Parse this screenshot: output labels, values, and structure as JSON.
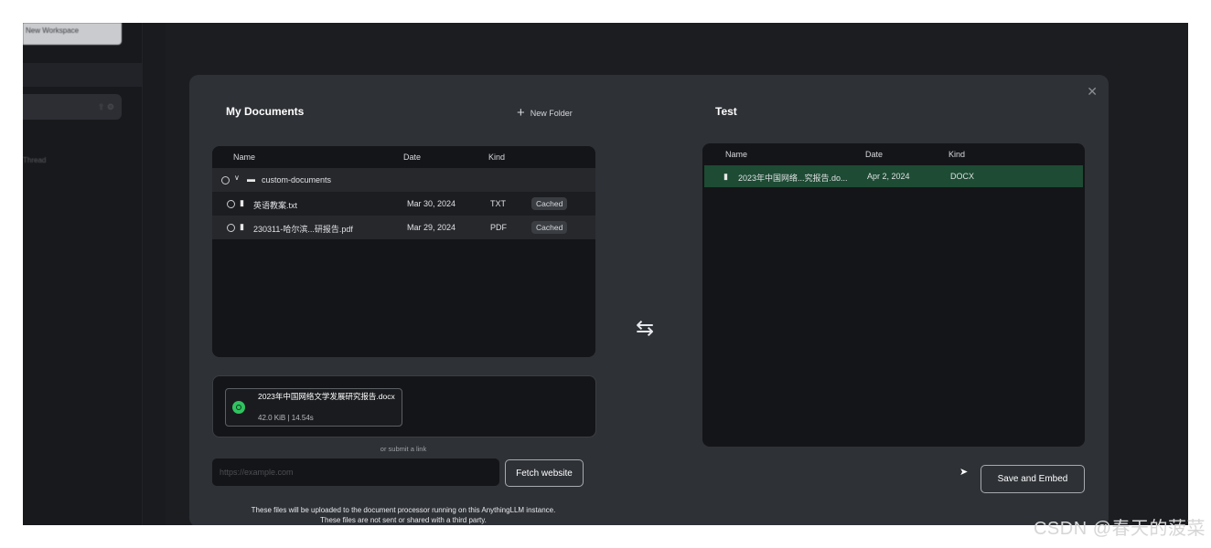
{
  "sidebar": {
    "workspace_button": "New Workspace",
    "thread_label": "Thread"
  },
  "my_documents": {
    "title": "My Documents",
    "new_folder": "New Folder",
    "columns": {
      "name": "Name",
      "date": "Date",
      "kind": "Kind"
    },
    "folder": {
      "name": "custom-documents"
    },
    "files": [
      {
        "name": "英语教案.txt",
        "date": "Mar 30, 2024",
        "kind": "TXT",
        "status": "Cached"
      },
      {
        "name": "230311-哈尔滨...研报告.pdf",
        "date": "Mar 29, 2024",
        "kind": "PDF",
        "status": "Cached"
      }
    ]
  },
  "workspace": {
    "title": "Test",
    "columns": {
      "name": "Name",
      "date": "Date",
      "kind": "Kind"
    },
    "files": [
      {
        "name": "2023年中国网络...究报告.do...",
        "date": "Apr 2, 2024",
        "kind": "DOCX"
      }
    ]
  },
  "upload": {
    "file_name": "2023年中国网络文学发展研究报告.docx",
    "file_meta": "42.0 KiB | 14.54s"
  },
  "link": {
    "or_label": "or submit a link",
    "placeholder": "https://example.com",
    "fetch_label": "Fetch website"
  },
  "notice": {
    "line1": "These files will be uploaded to the document processor running on this AnythingLLM instance.",
    "line2": "These files are not sent or shared with a third party."
  },
  "save_button": "Save and Embed",
  "watermark": "CSDN @春天的菠菜",
  "colors": {
    "selected_row": "#1d4b33",
    "success": "#2fc45f",
    "modal_bg": "#2e3136"
  }
}
